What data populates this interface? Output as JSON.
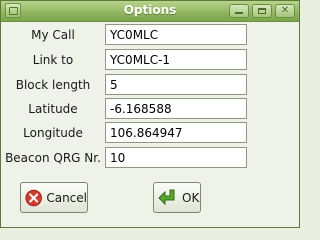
{
  "window": {
    "title": "Options"
  },
  "form": {
    "rows": [
      {
        "label": "My Call",
        "value": "YC0MLC"
      },
      {
        "label": "Link to",
        "value": "YC0MLC-1"
      },
      {
        "label": "Block length",
        "value": "5"
      },
      {
        "label": "Latitude",
        "value": "-6.168588"
      },
      {
        "label": "Longitude",
        "value": "106.864947"
      },
      {
        "label": "Beacon QRG Nr.",
        "value": "10"
      }
    ]
  },
  "buttons": {
    "cancel_label": "Cancel",
    "ok_label": "OK"
  },
  "colors": {
    "titlebar": "#8fb45e",
    "cancel_icon": "#d43a2a",
    "ok_icon": "#5aa82a"
  }
}
